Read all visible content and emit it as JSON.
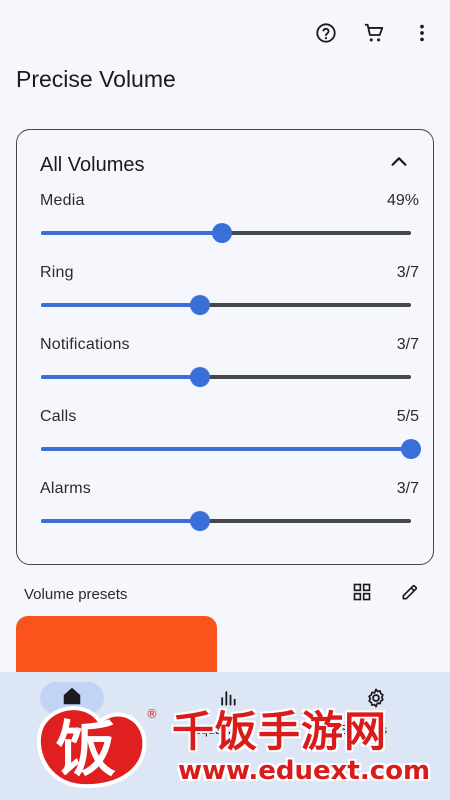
{
  "app_title": "Precise Volume",
  "toolbar": {
    "icons": [
      "help-circle-icon",
      "shopping-cart-icon",
      "more-vertical-icon"
    ]
  },
  "all_volumes": {
    "title": "All Volumes",
    "expanded": true,
    "rows": [
      {
        "label": "Media",
        "value": "49%",
        "level": 0.49
      },
      {
        "label": "Ring",
        "value": "3/7",
        "level": 0.4286
      },
      {
        "label": "Notifications",
        "value": "3/7",
        "level": 0.4286
      },
      {
        "label": "Calls",
        "value": "5/5",
        "level": 1.0
      },
      {
        "label": "Alarms",
        "value": "3/7",
        "level": 0.4286
      }
    ]
  },
  "presets": {
    "label": "Volume presets",
    "icons": [
      "grid-view-icon",
      "edit-pencil-icon"
    ],
    "card_color": "#fa541c"
  },
  "bottom_nav": {
    "items": [
      {
        "label": "Home",
        "icon": "home-icon",
        "active": true
      },
      {
        "label": "Equalizer",
        "icon": "equalizer-icon",
        "active": false
      },
      {
        "label": "Settings",
        "icon": "settings-gear-icon",
        "active": false
      }
    ]
  },
  "colors": {
    "accent": "#3b6fd8",
    "track": "#44474f",
    "background": "#f6f7fd",
    "nav_background": "#dde6f4"
  },
  "watermark": {
    "title": "千饭手游网",
    "url": "www.eduext.com",
    "logo_text": "饭",
    "mark": "®"
  }
}
